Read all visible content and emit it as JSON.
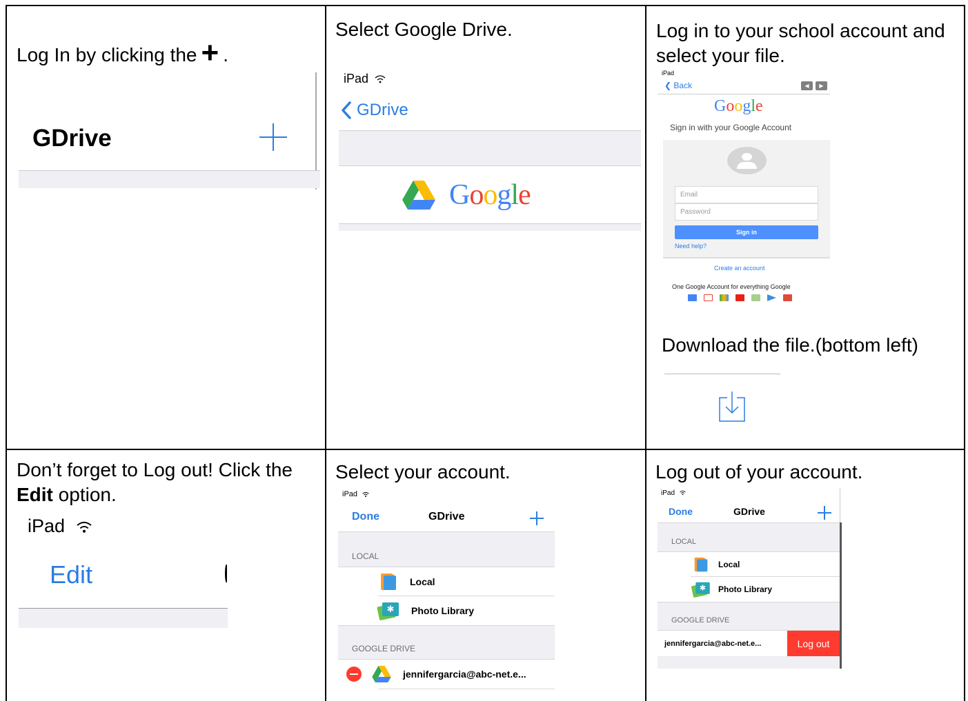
{
  "cells": {
    "step1": {
      "instruction_prefix": "Log In by clicking the",
      "instruction_plus": "+",
      "instruction_suffix": ".",
      "nav_title": "GDrive"
    },
    "step2": {
      "instruction": "Select Google Drive.",
      "status_device": "iPad",
      "back_label": "GDrive",
      "google_label": "Google"
    },
    "step3": {
      "instruction": "Log in to your school account and select your file.",
      "status_device": "iPad",
      "back_label": "Back",
      "google_label": "Google",
      "signin_subtitle": "Sign in with your Google Account",
      "email_placeholder": "Email",
      "password_placeholder": "Password",
      "signin_button": "Sign in",
      "need_help": "Need help?",
      "create_account": "Create an account",
      "one_account": "One Google Account for everything Google",
      "download_instruction": "Download the file.(bottom left)"
    },
    "step4": {
      "instruction_prefix": "Don’t forget to Log out! Click the",
      "instruction_bold": "Edit",
      "instruction_suffix": "option.",
      "status_device": "iPad",
      "edit_label": "Edit"
    },
    "step5": {
      "instruction": "Select your account.",
      "status_device": "iPad",
      "done_label": "Done",
      "nav_title": "GDrive",
      "section_local": "LOCAL",
      "row_local": "Local",
      "row_photo": "Photo Library",
      "section_gdrive": "GOOGLE DRIVE",
      "row_account": "jennifergarcia@abc-net.e..."
    },
    "step6": {
      "instruction": "Log out of your account.",
      "status_device": "iPad",
      "done_label": "Done",
      "nav_title": "GDrive",
      "section_local": "LOCAL",
      "row_local": "Local",
      "row_photo": "Photo Library",
      "section_gdrive": "GOOGLE DRIVE",
      "row_account": "jennifergarcia@abc-net.e...",
      "logout_label": "Log out"
    }
  },
  "colors": {
    "ios_blue": "#2a7de1",
    "ios_red": "#ff3b30",
    "google_blue": "#4285f4",
    "google_red": "#ea4335",
    "google_yellow": "#fbbc05",
    "google_green": "#34a853"
  }
}
